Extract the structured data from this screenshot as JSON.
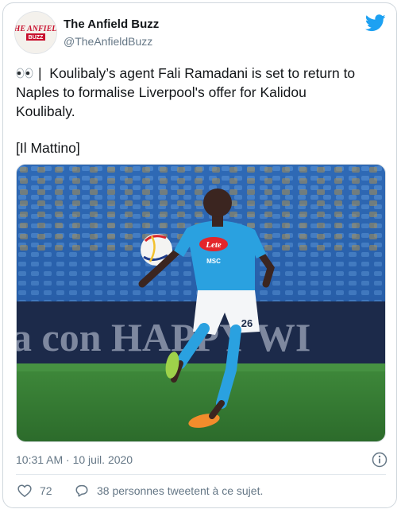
{
  "tweet": {
    "display_name": "The Anfield Buzz",
    "handle": "@TheAnfieldBuzz",
    "logo_text": "THE ANFIELD BUZZ",
    "text_line_1": "Koulibaly’s agent Fali Ramadani is set to return to",
    "text_line_2": "Naples to formalise Liverpool's offer for Kalidou",
    "text_line_3": "Koulibaly.",
    "source": "[Il Mattino]",
    "separator": "|",
    "timestamp": "10:31 AM · 10 juil. 2020",
    "likes_count": "72",
    "reply_text": "38 personnes tweetent à ce sujet."
  },
  "photo": {
    "banner_text": "a con HAPPY WI",
    "sponsor_text": "Lete",
    "kit_text": "MSC",
    "shirt_number": "26"
  },
  "colors": {
    "twitter_blue": "#1da1f2",
    "muted": "#657786",
    "text": "#14171a",
    "kit_blue": "#2aa1e0"
  },
  "icons": {
    "bird": "twitter-bird-icon",
    "eyes": "eyes-emoji-icon",
    "info": "info-icon",
    "like": "heart-icon",
    "reply": "speech-bubble-icon"
  }
}
